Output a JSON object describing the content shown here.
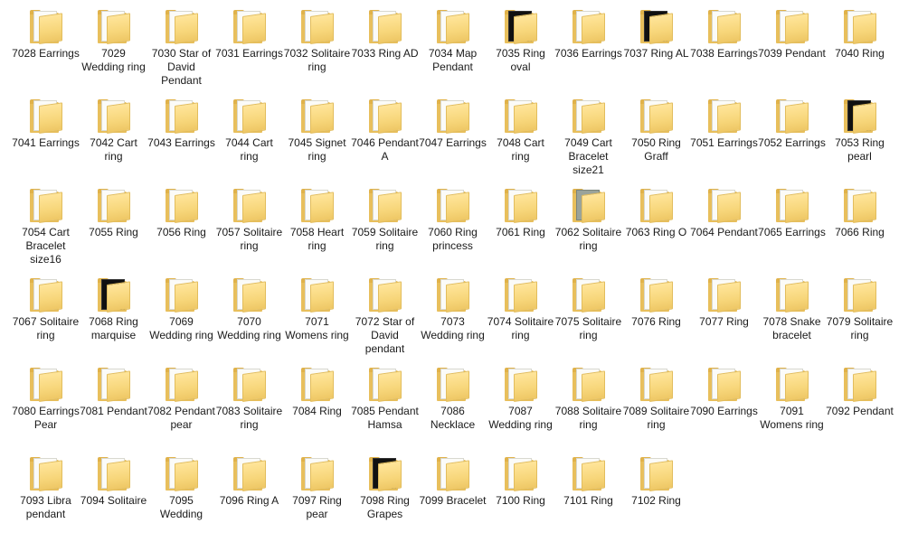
{
  "folders": [
    {
      "label": "7028 Earrings",
      "jewel": "stone",
      "paper": "light"
    },
    {
      "label": "7029 Wedding ring",
      "jewel": "green",
      "paper": "light"
    },
    {
      "label": "7030 Star of David Pendant",
      "jewel": "stone",
      "paper": "light"
    },
    {
      "label": "7031 Earrings",
      "jewel": "gold",
      "paper": "light"
    },
    {
      "label": "7032 Solitaire ring",
      "jewel": "gold",
      "paper": "light"
    },
    {
      "label": "7033 Ring AD",
      "jewel": "gold",
      "paper": "light"
    },
    {
      "label": "7034 Map Pendant",
      "jewel": "stone",
      "paper": "light"
    },
    {
      "label": "7035 Ring oval",
      "jewel": "teal",
      "paper": "dark"
    },
    {
      "label": "7036 Earrings",
      "jewel": "stone",
      "paper": "light"
    },
    {
      "label": "7037 Ring AL",
      "jewel": "green",
      "paper": "dark"
    },
    {
      "label": "7038 Earrings",
      "jewel": "stone",
      "paper": "light"
    },
    {
      "label": "7039 Pendant",
      "jewel": "gold",
      "paper": "light"
    },
    {
      "label": "7040 Ring",
      "jewel": "gold",
      "paper": "light"
    },
    {
      "label": "7041 Earrings",
      "jewel": "stone",
      "paper": "light"
    },
    {
      "label": "7042 Cart ring",
      "jewel": "gold",
      "paper": "light"
    },
    {
      "label": "7043 Earrings",
      "jewel": "gold",
      "paper": "light"
    },
    {
      "label": "7044 Cart ring",
      "jewel": "gold",
      "paper": "light"
    },
    {
      "label": "7045 Signet ring",
      "jewel": "gold",
      "paper": "light"
    },
    {
      "label": "7046 Pendant A",
      "jewel": "stone",
      "paper": "light"
    },
    {
      "label": "7047 Earrings",
      "jewel": "stone",
      "paper": "light"
    },
    {
      "label": "7048 Cart ring",
      "jewel": "gold",
      "paper": "light"
    },
    {
      "label": "7049 Cart Bracelet size21",
      "jewel": "white",
      "paper": "light"
    },
    {
      "label": "7050 Ring Graff",
      "jewel": "gold",
      "paper": "light"
    },
    {
      "label": "7051 Earrings",
      "jewel": "stone",
      "paper": "light"
    },
    {
      "label": "7052 Earrings",
      "jewel": "gold",
      "paper": "light"
    },
    {
      "label": "7053 Ring pearl",
      "jewel": "white",
      "paper": "dark"
    },
    {
      "label": "7054 Cart Bracelet size16",
      "jewel": "gold",
      "paper": "light"
    },
    {
      "label": "7055 Ring",
      "jewel": "stone",
      "paper": "light"
    },
    {
      "label": "7056 Ring",
      "jewel": "gold",
      "paper": "light"
    },
    {
      "label": "7057 Solitaire ring",
      "jewel": "stone",
      "paper": "light"
    },
    {
      "label": "7058 Heart ring",
      "jewel": "stone",
      "paper": "light"
    },
    {
      "label": "7059 Solitaire ring",
      "jewel": "stone",
      "paper": "light"
    },
    {
      "label": "7060 Ring princess",
      "jewel": "gold",
      "paper": "light"
    },
    {
      "label": "7061 Ring",
      "jewel": "stone",
      "paper": "light"
    },
    {
      "label": "7062 Solitaire ring",
      "jewel": "green",
      "paper": "gray"
    },
    {
      "label": "7063 Ring O",
      "jewel": "stone",
      "paper": "light"
    },
    {
      "label": "7064 Pendant",
      "jewel": "green",
      "paper": "light"
    },
    {
      "label": "7065 Earrings",
      "jewel": "stone",
      "paper": "light"
    },
    {
      "label": "7066 Ring",
      "jewel": "gold",
      "paper": "light"
    },
    {
      "label": "7067 Solitaire ring",
      "jewel": "stone",
      "paper": "light"
    },
    {
      "label": "7068 Ring marquise",
      "jewel": "gold",
      "paper": "dark"
    },
    {
      "label": "7069 Wedding ring",
      "jewel": "stone",
      "paper": "light"
    },
    {
      "label": "7070 Wedding ring",
      "jewel": "stone",
      "paper": "light"
    },
    {
      "label": "7071 Womens ring",
      "jewel": "gold",
      "paper": "light"
    },
    {
      "label": "7072 Star of David pendant",
      "jewel": "stone",
      "paper": "light"
    },
    {
      "label": "7073 Wedding ring",
      "jewel": "gold",
      "paper": "light"
    },
    {
      "label": "7074 Solitaire ring",
      "jewel": "gold",
      "paper": "light"
    },
    {
      "label": "7075 Solitaire ring",
      "jewel": "gold",
      "paper": "light"
    },
    {
      "label": "7076 Ring",
      "jewel": "gold",
      "paper": "light"
    },
    {
      "label": "7077 Ring",
      "jewel": "gold",
      "paper": "light"
    },
    {
      "label": "7078 Snake bracelet",
      "jewel": "white",
      "paper": "light"
    },
    {
      "label": "7079 Solitaire ring",
      "jewel": "gold",
      "paper": "light"
    },
    {
      "label": "7080 Earrings Pear",
      "jewel": "stone",
      "paper": "light"
    },
    {
      "label": "7081 Pendant",
      "jewel": "stone",
      "paper": "light"
    },
    {
      "label": "7082 Pendant pear",
      "jewel": "stone",
      "paper": "light"
    },
    {
      "label": "7083 Solitaire ring",
      "jewel": "gold",
      "paper": "light"
    },
    {
      "label": "7084 Ring",
      "jewel": "stone",
      "paper": "light"
    },
    {
      "label": "7085 Pendant Hamsa",
      "jewel": "stone",
      "paper": "light"
    },
    {
      "label": "7086 Necklace",
      "jewel": "white",
      "paper": "light"
    },
    {
      "label": "7087 Wedding ring",
      "jewel": "green",
      "paper": "light"
    },
    {
      "label": "7088 Solitaire ring",
      "jewel": "stone",
      "paper": "light"
    },
    {
      "label": "7089 Solitaire ring",
      "jewel": "gold",
      "paper": "light"
    },
    {
      "label": "7090 Earrings",
      "jewel": "stone",
      "paper": "light"
    },
    {
      "label": "7091 Womens ring",
      "jewel": "stone",
      "paper": "light"
    },
    {
      "label": "7092 Pendant",
      "jewel": "green",
      "paper": "light"
    },
    {
      "label": "7093 Libra pendant",
      "jewel": "gold",
      "paper": "light"
    },
    {
      "label": "7094 Solitaire",
      "jewel": "stone",
      "paper": "light"
    },
    {
      "label": "7095 Wedding",
      "jewel": "gold",
      "paper": "light"
    },
    {
      "label": "7096 Ring A",
      "jewel": "gold",
      "paper": "light"
    },
    {
      "label": "7097 Ring pear",
      "jewel": "gold",
      "paper": "light"
    },
    {
      "label": "7098 Ring Grapes",
      "jewel": "gold",
      "paper": "dark"
    },
    {
      "label": "7099 Bracelet",
      "jewel": "gold",
      "paper": "light"
    },
    {
      "label": "7100 Ring",
      "jewel": "gold",
      "paper": "light"
    },
    {
      "label": "7101 Ring",
      "jewel": "gold",
      "paper": "light"
    },
    {
      "label": "7102 Ring",
      "jewel": "gold",
      "paper": "light"
    }
  ]
}
